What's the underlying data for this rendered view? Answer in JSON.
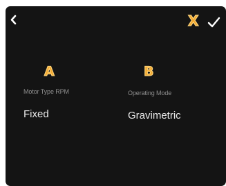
{
  "header": {
    "back_icon": "chevron-left-icon",
    "confirm_icon": "checkmark-icon",
    "close_marker": "X"
  },
  "fields": [
    {
      "marker": "A",
      "label": "Motor Type RPM",
      "value": "Fixed"
    },
    {
      "marker": "B",
      "label": "Operating Mode",
      "value": "Gravimetric"
    }
  ],
  "colors": {
    "background": "#141414",
    "marker": "#f4a92f",
    "label": "#8f8f8f",
    "value": "#e9e9e9",
    "icon": "#ffffff"
  }
}
